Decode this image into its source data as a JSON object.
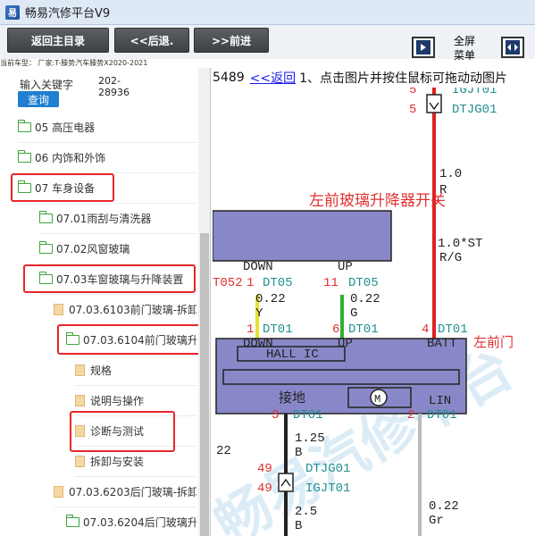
{
  "window": {
    "title": "畅易汽修平台V9"
  },
  "toolbar": {
    "home_label": "返回主目录",
    "back_label": "<<后退.",
    "forward_label": ">>前进",
    "fullscreen_line1": "全屏",
    "fullscreen_line2": "菜单"
  },
  "model_line": "当前车型：  厂家:T-滕势汽车滕势X2020-2021",
  "search": {
    "keyword_label": "输入关键字",
    "keyword_value_line1": "202-",
    "keyword_value_line2": "28936",
    "query_label": "查询"
  },
  "tree": {
    "items": [
      {
        "label": "05 高压电器"
      },
      {
        "label": "06 内饰和外饰"
      },
      {
        "label": "07 车身设备"
      },
      {
        "label": "07.01雨刮与清洗器"
      },
      {
        "label": "07.02风窗玻璃"
      },
      {
        "label": "07.03车窗玻璃与升降装置"
      },
      {
        "label": "07.03.6103前门玻璃-拆卸"
      },
      {
        "label": "07.03.6104前门玻璃升"
      },
      {
        "label": "规格"
      },
      {
        "label": "说明与操作"
      },
      {
        "label": "诊断与测试"
      },
      {
        "label": "拆卸与安装"
      },
      {
        "label": "07.03.6203后门玻璃-拆卸"
      },
      {
        "label": "07.03.6204后门玻璃升"
      }
    ]
  },
  "content": {
    "page_number": "5489",
    "back_link": "<<返回",
    "instruction": "1、点击图片并按住鼠标可拖动动图片"
  },
  "diagram": {
    "switch_title": "左前玻璃升降器开关",
    "right_edge_label": "左前门",
    "top_pin1": "5",
    "top_pin1_code": "IGJT01",
    "top_pin2": "5",
    "top_pin2_code": "DTJG01",
    "wire_size_top": "1.0",
    "wire_color_top": "R",
    "wire_mid_spec": "1.0*ST",
    "wire_mid_color": "R/G",
    "down_label": "DOWN",
    "up_label": "UP",
    "wire_left_code": "T052",
    "left_pin_code": "DT05",
    "left_pin_num": "1",
    "right_pin_code": "DT05",
    "right_pin_num": "11",
    "left_size": "0.22",
    "left_color": "Y",
    "right_size": "0.22",
    "right_color": "G",
    "bottom_left_num": "1",
    "bottom_left_code": "DT01",
    "bottom_mid_num": "6",
    "bottom_mid_code": "DT01",
    "bottom_right_num": "4",
    "bottom_right_code": "DT01",
    "module_down": "DOWN",
    "module_up": "UP",
    "module_batt": "BATT",
    "hall_label": "HALL IC",
    "ground_label": "接地",
    "lin_label": "LIN",
    "motor_label": "M",
    "gnd_pin": "3",
    "gnd_code": "DT01",
    "lin_pin": "2",
    "lin_code": "DT01",
    "gnd_size": "1.25",
    "gnd_color": "B",
    "left_edge_num": "22",
    "conn_pin1": "49",
    "conn_code1": "DTJG01",
    "conn_pin2": "49",
    "conn_code2": "IGJT01",
    "bottom_size": "2.5",
    "bottom_color": "B",
    "lin_size": "0.22",
    "lin_color": "Gr",
    "watermark": "畅易汽修平台"
  },
  "colors": {
    "red_wire": "#e02020",
    "yellow_wire": "#e8e030",
    "green_wire": "#30b030",
    "module_fill": "#8888c8",
    "label_red": "#e03030",
    "label_teal": "#208f8f"
  }
}
